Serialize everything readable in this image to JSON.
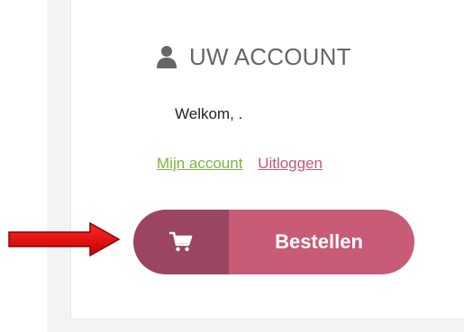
{
  "account": {
    "heading": "UW ACCOUNT",
    "welcome_text": "Welkom, .",
    "links": {
      "my_account": "Mijn account",
      "logout": "Uitloggen"
    }
  },
  "order_button": {
    "label": "Bestellen",
    "icon": "cart-icon"
  },
  "colors": {
    "link_green": "#7cb342",
    "link_rose": "#c15a73",
    "button_dark": "#9b4561",
    "button_light": "#c85b76",
    "annotation_arrow": "#e00000"
  },
  "annotations": {
    "arrow": "red-arrow-pointing-right"
  }
}
